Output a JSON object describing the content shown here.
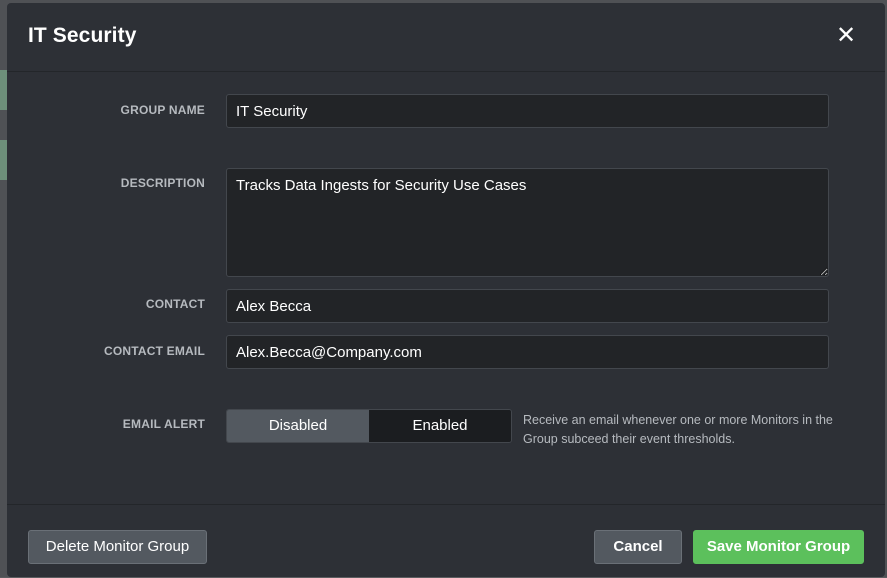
{
  "dialog": {
    "title": "IT Security",
    "close_symbol": "✕",
    "close_icon": "close-icon"
  },
  "form": {
    "group_name": {
      "label": "GROUP NAME",
      "value": "IT Security"
    },
    "description": {
      "label": "DESCRIPTION",
      "value": "Tracks Data Ingests for Security Use Cases"
    },
    "contact": {
      "label": "CONTACT",
      "value": "Alex Becca"
    },
    "contact_email": {
      "label": "CONTACT EMAIL",
      "value": "Alex.Becca@Company.com"
    },
    "email_alert": {
      "label": "EMAIL ALERT",
      "options": [
        "Disabled",
        "Enabled"
      ],
      "selected": "Disabled",
      "help": "Receive an email whenever one or more Monitors in the Group subceed their event thresholds."
    }
  },
  "footer": {
    "delete_label": "Delete Monitor Group",
    "cancel_label": "Cancel",
    "save_label": "Save Monitor Group"
  },
  "colors": {
    "modal_bg": "#2d3036",
    "accent_green": "#5cc05c",
    "button_gray": "#535960"
  }
}
